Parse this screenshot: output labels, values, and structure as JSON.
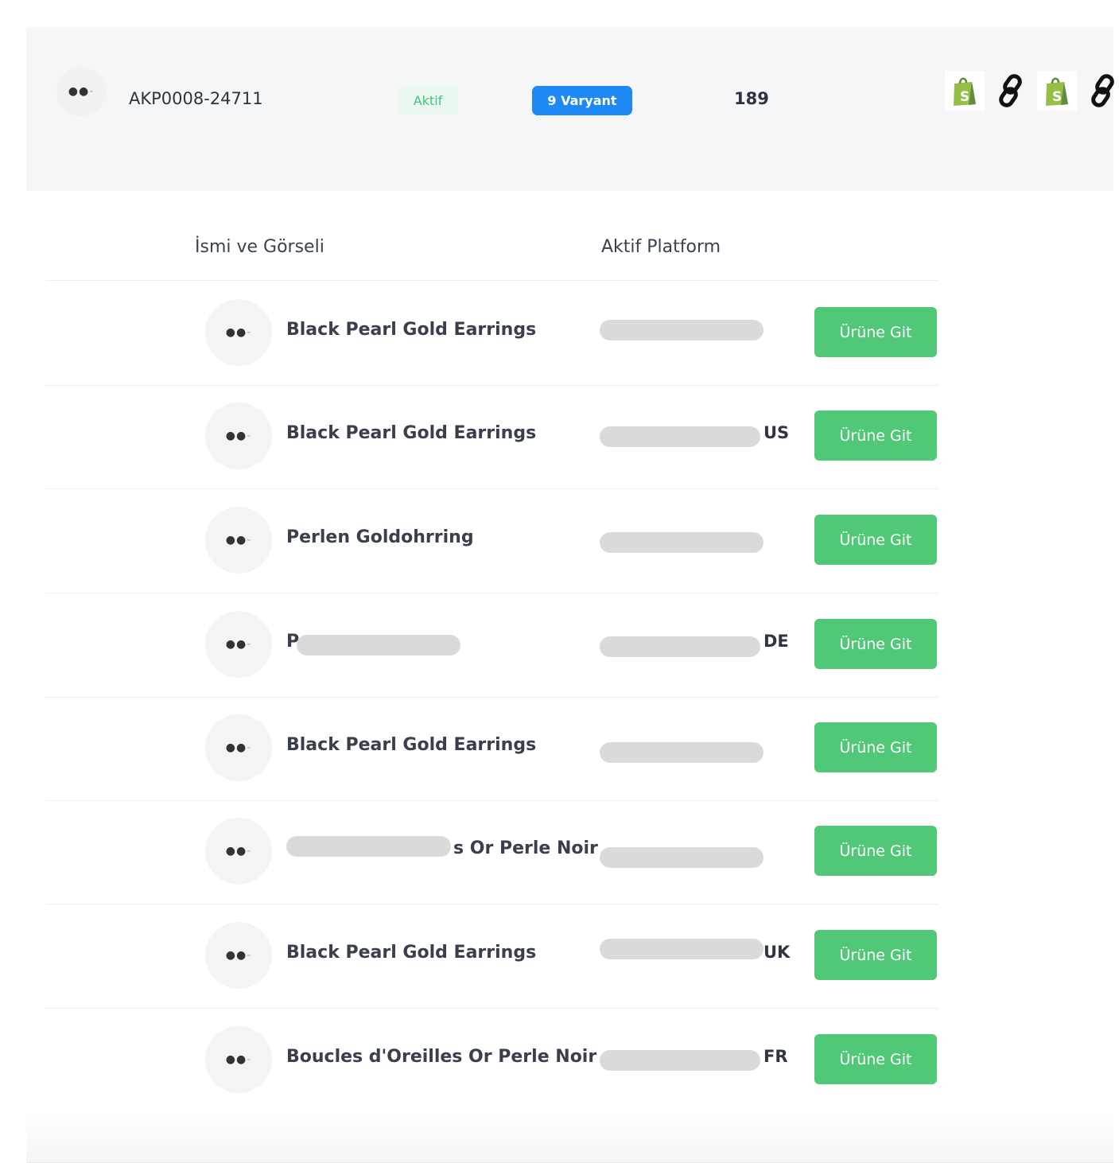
{
  "product": {
    "sku": "AKP0008-24711",
    "status": "Aktif",
    "variant_badge": "9 Varyant",
    "count": "189",
    "platform_icons": [
      "shopify-icon",
      "link-icon",
      "shopify-icon",
      "link-icon"
    ]
  },
  "table": {
    "headers": {
      "name": "İsmi ve Görseli",
      "platform": "Aktif Platform"
    },
    "button_label": "Ürüne Git",
    "rows": [
      {
        "name": "Black Pearl Gold Earrings",
        "platform_suffix": ""
      },
      {
        "name": "Black Pearl Gold Earrings",
        "platform_suffix": "US"
      },
      {
        "name": "Perlen Goldohrring",
        "platform_suffix": ""
      },
      {
        "name": "P",
        "platform_suffix": "DE"
      },
      {
        "name": "Black Pearl Gold Earrings",
        "platform_suffix": ""
      },
      {
        "name": "s Or Perle Noir",
        "platform_suffix": ""
      },
      {
        "name": "Black Pearl Gold Earrings",
        "platform_suffix": "UK"
      },
      {
        "name": "Boucles d'Oreilles Or Perle Noir",
        "platform_suffix": "FR"
      }
    ]
  },
  "colors": {
    "accent_green": "#50c878",
    "badge_blue": "#1e88f5",
    "status_green": "#3fc77f"
  }
}
